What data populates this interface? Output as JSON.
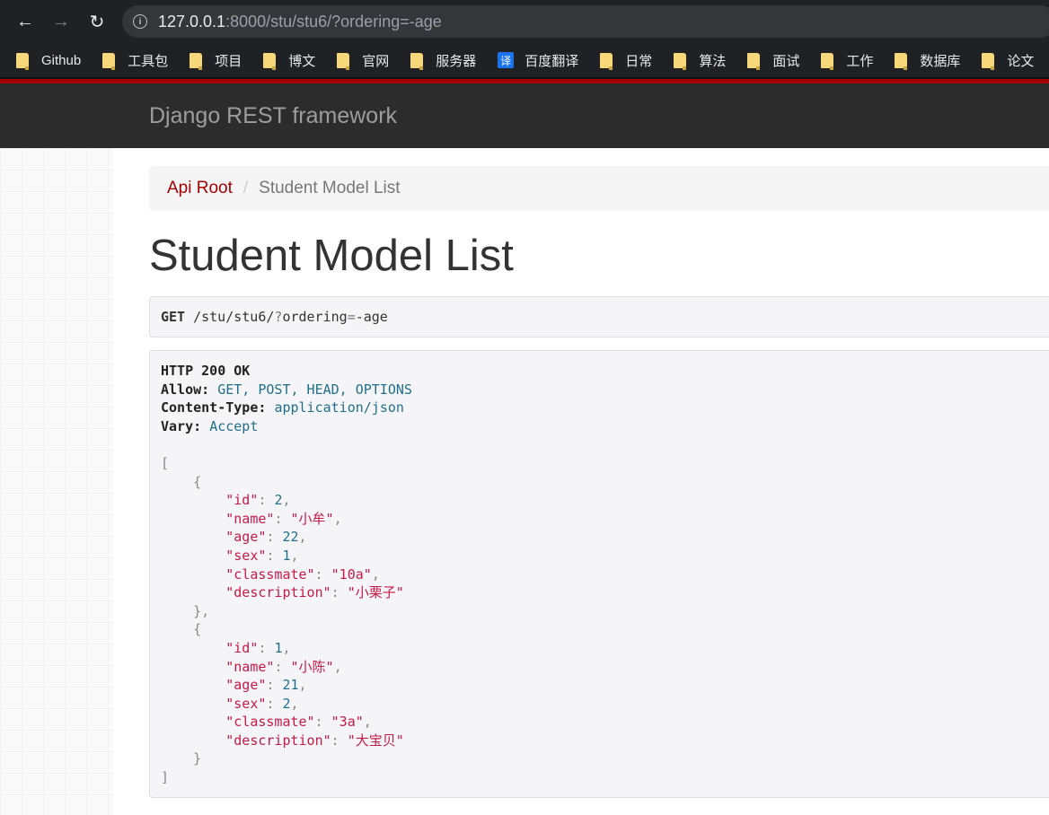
{
  "browser": {
    "url_host": "127.0.0.1",
    "url_rest": ":8000/stu/stu6/?ordering=-age",
    "back_glyph": "←",
    "forward_glyph": "→",
    "reload_glyph": "↻",
    "info_glyph": "i"
  },
  "bookmarks": [
    {
      "label": "Github",
      "icon": "folder-icon"
    },
    {
      "label": "工具包",
      "icon": "folder-icon"
    },
    {
      "label": "项目",
      "icon": "folder-icon"
    },
    {
      "label": "博文",
      "icon": "folder-icon"
    },
    {
      "label": "官网",
      "icon": "folder-icon"
    },
    {
      "label": "服务器",
      "icon": "folder-icon"
    },
    {
      "label": "百度翻译",
      "icon": "translate-icon",
      "icon_glyph": "译"
    },
    {
      "label": "日常",
      "icon": "folder-icon"
    },
    {
      "label": "算法",
      "icon": "folder-icon"
    },
    {
      "label": "面试",
      "icon": "folder-icon"
    },
    {
      "label": "工作",
      "icon": "folder-icon"
    },
    {
      "label": "数据库",
      "icon": "folder-icon"
    },
    {
      "label": "论文",
      "icon": "folder-icon"
    }
  ],
  "navbar": {
    "brand": "Django REST framework"
  },
  "breadcrumb": {
    "root": "Api Root",
    "separator": "/",
    "current": "Student Model List"
  },
  "page": {
    "title": "Student Model List"
  },
  "request": {
    "method": "GET",
    "path": "/stu/stu6/",
    "query_prefix": "?",
    "query": "ordering",
    "query_eq": "=",
    "query_value": "-age"
  },
  "response": {
    "status_line": "HTTP 200 OK",
    "headers": [
      {
        "key": "Allow:",
        "value": "GET, POST, HEAD, OPTIONS"
      },
      {
        "key": "Content-Type:",
        "value": "application/json"
      },
      {
        "key": "Vary:",
        "value": "Accept"
      }
    ],
    "items": [
      {
        "id": "2",
        "name": "\"小牟\"",
        "age": "22",
        "sex": "1",
        "classmate": "\"10a\"",
        "description": "\"小栗子\""
      },
      {
        "id": "1",
        "name": "\"小陈\"",
        "age": "21",
        "sex": "2",
        "classmate": "\"3a\"",
        "description": "\"大宝贝\""
      }
    ],
    "keys": {
      "id": "\"id\"",
      "name": "\"name\"",
      "age": "\"age\"",
      "sex": "\"sex\"",
      "classmate": "\"classmate\"",
      "description": "\"description\""
    }
  },
  "colors": {
    "accent": "#a30000",
    "navbar": "#2c2c2c",
    "json_key": "#c41a4a",
    "json_num": "#1f6f8b"
  }
}
